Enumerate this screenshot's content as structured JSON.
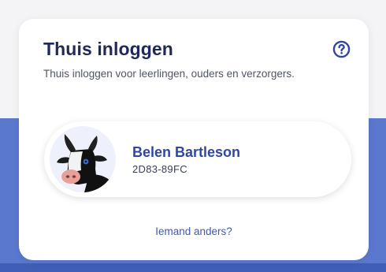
{
  "login_card": {
    "title": "Thuis inloggen",
    "subtitle": "Thuis inloggen voor leerlingen, ouders en verzorgers.",
    "help_icon": "question-circle-icon"
  },
  "profile": {
    "name": "Belen Bartleson",
    "code": "2D83-89FC",
    "avatar_icon": "cow-avatar-icon"
  },
  "other_user_link": "Iemand anders?",
  "colors": {
    "background_blue": "#5b78cf",
    "title": "#22295a",
    "accent_blue": "#2e47a6"
  }
}
